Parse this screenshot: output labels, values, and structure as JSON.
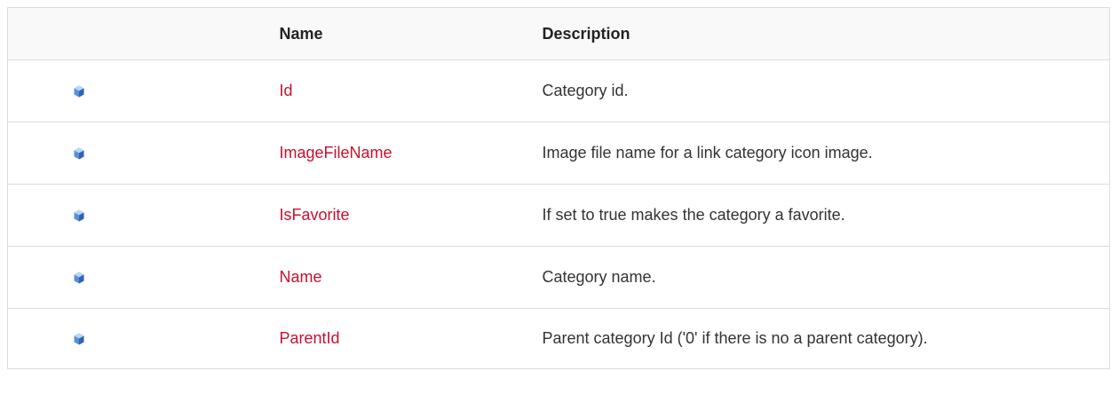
{
  "table": {
    "headers": {
      "icon": "",
      "name": "Name",
      "description": "Description"
    },
    "rows": [
      {
        "icon": "public-property-icon",
        "name": "Id",
        "description": "Category id."
      },
      {
        "icon": "public-property-icon",
        "name": "ImageFileName",
        "description": "Image file name for a link category icon image."
      },
      {
        "icon": "public-property-icon",
        "name": "IsFavorite",
        "description": "If set to true makes the category a favorite."
      },
      {
        "icon": "public-property-icon",
        "name": "Name",
        "description": "Category name."
      },
      {
        "icon": "public-property-icon",
        "name": "ParentId",
        "description": "Parent category Id ('0' if there is no a parent category)."
      }
    ]
  },
  "colors": {
    "link": "#c8102e",
    "border": "#dcdcdc",
    "header_bg": "#f9f9f9"
  }
}
